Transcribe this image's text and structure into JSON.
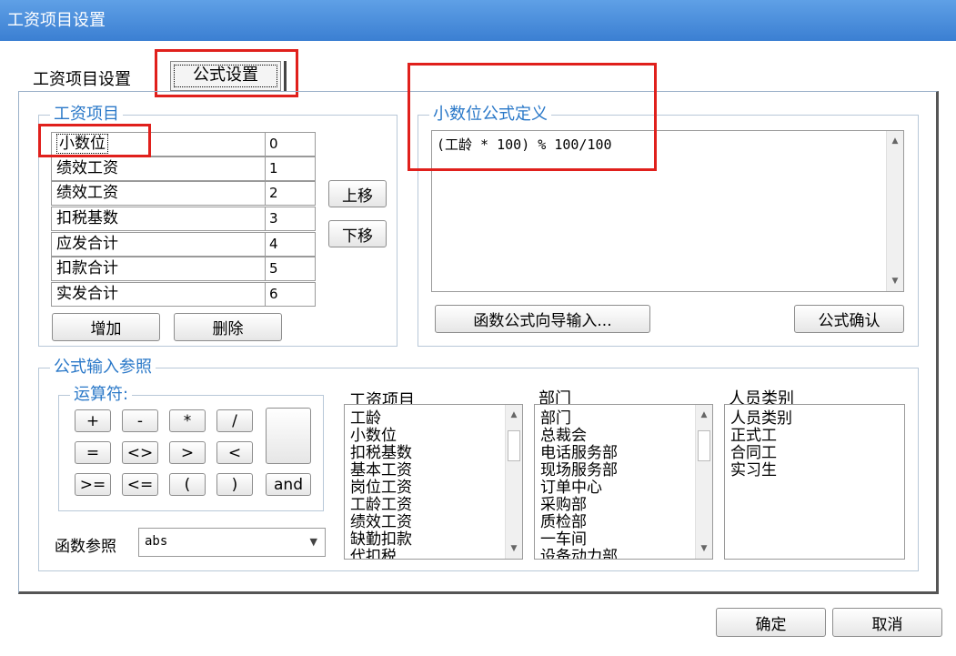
{
  "window": {
    "title": "工资项目设置"
  },
  "tabs": {
    "tab1_label": "工资项目设置",
    "tab2_label": "公式设置"
  },
  "salary_items": {
    "title": "工资项目",
    "rows": [
      {
        "name": "小数位",
        "num": "0"
      },
      {
        "name": "绩效工资",
        "num": "1"
      },
      {
        "name": "绩效工资",
        "num": "2"
      },
      {
        "name": "扣税基数",
        "num": "3"
      },
      {
        "name": "应发合计",
        "num": "4"
      },
      {
        "name": "扣款合计",
        "num": "5"
      },
      {
        "name": "实发合计",
        "num": "6"
      }
    ],
    "move_up": "上移",
    "move_down": "下移",
    "add": "增加",
    "delete": "删除"
  },
  "formula_def": {
    "title": "小数位公式定义",
    "text": "(工龄 * 100) % 100/100",
    "wizard_button": "函数公式向导输入...",
    "confirm_button": "公式确认"
  },
  "formula_ref": {
    "title": "公式输入参照",
    "operators_title": "运算符:",
    "operators": [
      "+",
      "-",
      "*",
      "/",
      "=",
      "<>",
      ">",
      "<",
      ">=",
      "<=",
      "(",
      ")",
      "and"
    ],
    "func_label": "函数参照",
    "func_value": "abs",
    "col1_head": "工资项目",
    "col1_items": [
      "工龄",
      "小数位",
      "扣税基数",
      "基本工资",
      "岗位工资",
      "工龄工资",
      "绩效工资",
      "缺勤扣款",
      "代扣税"
    ],
    "col2_head": "部门",
    "col2_items": [
      "部门",
      "总裁会",
      "电话服务部",
      "现场服务部",
      "订单中心",
      "采购部",
      "质检部",
      "一车间",
      "设备动力部"
    ],
    "col3_head": "人员类别",
    "col3_items": [
      "人员类别",
      "正式工",
      "合同工",
      "实习生"
    ]
  },
  "footer": {
    "ok": "确定",
    "cancel": "取消"
  },
  "colors": {
    "title_bar": "#3b7fd2",
    "group_title": "#2a78c8",
    "annotation": "#e0201c"
  },
  "icons": [
    "scroll-up-icon",
    "scroll-down-icon",
    "dropdown-arrow-icon"
  ]
}
